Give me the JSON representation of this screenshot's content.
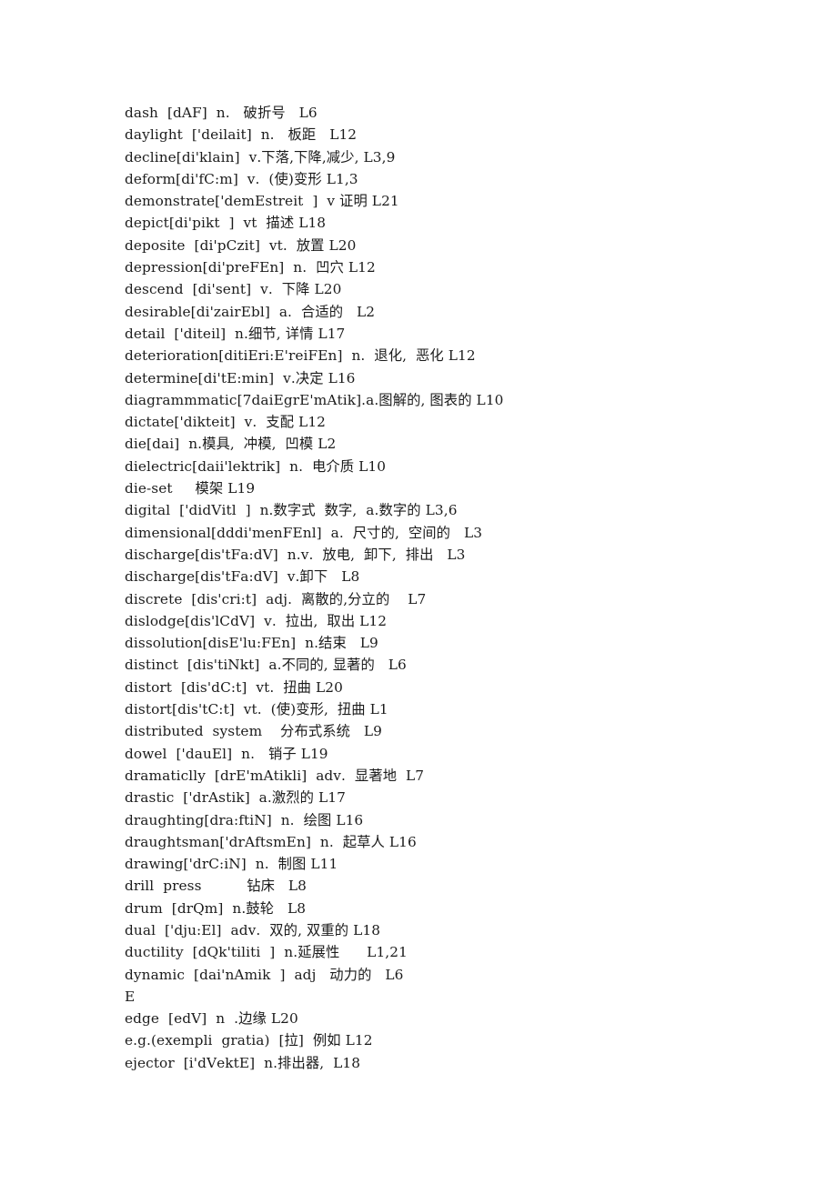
{
  "document": {
    "type": "glossary-page",
    "language_note": "English-Chinese technical vocabulary list",
    "text_color": "#1b1b1b",
    "background_color": "#ffffff",
    "entries": [
      "dash  [dAF]  n.   破折号   L6",
      "daylight  ['deilait]  n.   板距   L12",
      "decline[di'klain]  v.下落,下降,减少, L3,9",
      "deform[di'fC:m]  v.  (使)变形 L1,3",
      "demonstrate['demEstreit  ]  v 证明 L21",
      "depict[di'pikt  ]  vt  描述 L18",
      "deposite  [di'pCzit]  vt.  放置 L20",
      "depression[di'preFEn]  n.  凹穴 L12",
      "descend  [di'sent]  v.  下降 L20",
      "desirable[di'zairEbl]  a.  合适的   L2",
      "detail  ['diteil]  n.细节, 详情 L17",
      "deterioration[ditiEri:E'reiFEn]  n.  退化,  恶化 L12",
      "determine[di'tE:min]  v.决定 L16",
      "diagrammmatic[7daiEgrE'mAtik].a.图解的, 图表的 L10",
      "dictate['dikteit]  v.  支配 L12",
      "die[dai]  n.模具,  冲模,  凹模 L2",
      "dielectric[daii'lektrik]  n.  电介质 L10",
      "die-set     模架 L19",
      "digital  ['didVitl  ]  n.数字式  数字,  a.数字的 L3,6",
      "dimensional[dddi'menFEnl]  a.  尺寸的,  空间的   L3",
      "discharge[dis'tFa:dV]  n.v.  放电,  卸下,  排出   L3",
      "discharge[dis'tFa:dV]  v.卸下   L8",
      "discrete  [dis'cri:t]  adj.  离散的,分立的    L7",
      "dislodge[dis'lCdV]  v.  拉出,  取出 L12",
      "dissolution[disE'lu:FEn]  n.结束   L9",
      "distinct  [dis'tiNkt]  a.不同的, 显著的   L6",
      "distort  [dis'dC:t]  vt.  扭曲 L20",
      "distort[dis'tC:t]  vt.  (使)变形,  扭曲 L1",
      "distributed  system    分布式系统   L9",
      "dowel  ['dauEl]  n.   销子 L19",
      "dramaticlly  [drE'mAtikli]  adv.  显著地  L7",
      "drastic  ['drAstik]  a.激烈的 L17",
      "draughting[dra:ftiN]  n.  绘图 L16",
      "draughtsman['drAftsmEn]  n.  起草人 L16",
      "drawing['drC:iN]  n.  制图 L11",
      "drill  press          钻床   L8",
      "drum  [drQm]  n.鼓轮   L8",
      "dual  ['dju:El]  adv.  双的, 双重的 L18",
      "ductility  [dQk'tiliti  ]  n.延展性      L1,21",
      "dynamic  [dai'nAmik  ]  adj   动力的   L6",
      "E",
      "edge  [edV]  n  .边缘 L20",
      "e.g.(exempli  gratia)  [拉]  例如 L12",
      "ejector  [i'dVektE]  n.排出器,  L18"
    ]
  }
}
